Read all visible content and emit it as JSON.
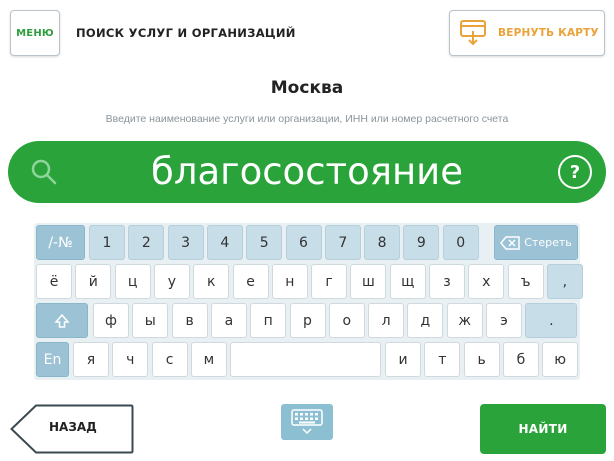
{
  "header": {
    "menu_label": "МЕНЮ",
    "title": "ПОИСК УСЛУГ И ОРГАНИЗАЦИЙ",
    "return_card_label": "ВЕРНУТЬ КАРТУ"
  },
  "city": "Москва",
  "hint": "Введите наименование услуги или организации, ИНН или номер расчетного счета",
  "search": {
    "value": "благосостояние",
    "help_glyph": "?"
  },
  "keyboard": {
    "row1": [
      "/-№",
      "1",
      "2",
      "3",
      "4",
      "5",
      "6",
      "7",
      "8",
      "9",
      "0"
    ],
    "erase_label": "Стереть",
    "row2": [
      "ё",
      "й",
      "ц",
      "у",
      "к",
      "е",
      "н",
      "г",
      "ш",
      "щ",
      "з",
      "х",
      "ъ",
      ","
    ],
    "row3": [
      "ф",
      "ы",
      "в",
      "а",
      "п",
      "р",
      "о",
      "л",
      "д",
      "ж",
      "э",
      "."
    ],
    "row4_left": [
      "я",
      "ч",
      "с",
      "м"
    ],
    "row4_right": [
      "и",
      "т",
      "ь",
      "б",
      "ю"
    ],
    "lang_label": "En"
  },
  "footer": {
    "back_label": "НАЗАД",
    "find_label": "НАЙТИ"
  },
  "colors": {
    "brand_green": "#2aa43a",
    "accent_orange": "#e9a33a",
    "key_blue": "#c7dde8",
    "key_dark_blue": "#9cc3d5"
  }
}
